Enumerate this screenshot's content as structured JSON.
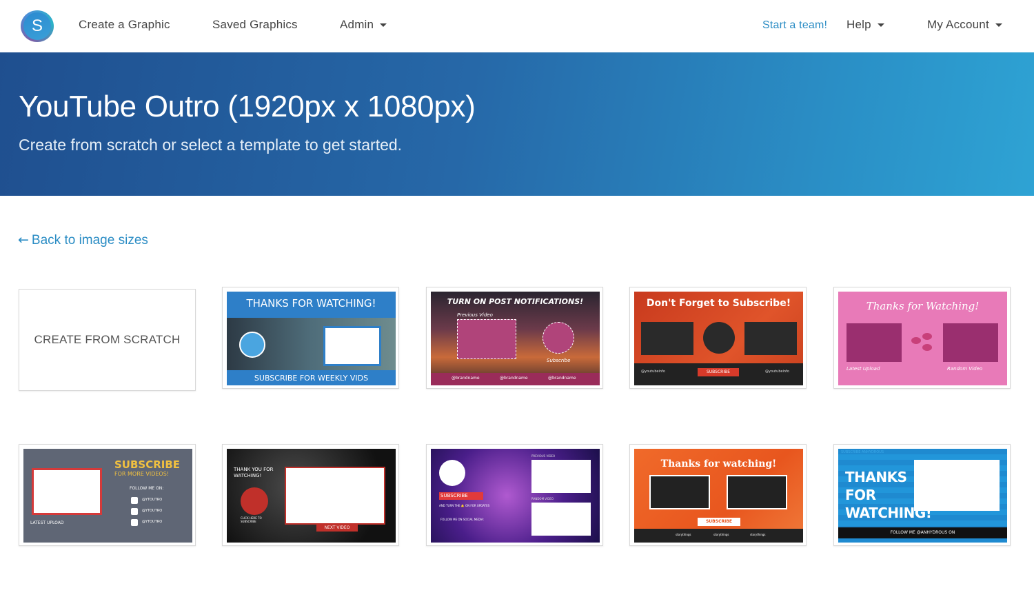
{
  "nav": {
    "logo_letter": "S",
    "create": "Create a Graphic",
    "saved": "Saved Graphics",
    "admin": "Admin",
    "team": "Start a team!",
    "help": "Help",
    "account": "My Account"
  },
  "banner": {
    "title": "YouTube Outro (1920px x 1080px)",
    "subtitle": "Create from scratch or select a template to get started."
  },
  "back_link": {
    "arrow": "←",
    "label": "Back to image sizes"
  },
  "scratch_label": "CREATE FROM SCRATCH",
  "templates": [
    {
      "heading": "THANKS FOR WATCHING!",
      "footer": "SUBSCRIBE FOR WEEKLY VIDS"
    },
    {
      "heading": "TURN ON POST NOTIFICATIONS!",
      "left": "Previous Video",
      "right": "Subscribe",
      "social_1": "@brandname",
      "social_2": "@brandname",
      "social_3": "@brandname"
    },
    {
      "heading": "Don't Forget to Subscribe!",
      "button": "SUBSCRIBE",
      "social_1": "@youtubeinfo",
      "social_2": "@youtubeinfo"
    },
    {
      "heading": "Thanks for Watching!",
      "left": "Latest Upload",
      "right": "Random Video"
    },
    {
      "heading": "SUBSCRIBE",
      "sub": "FOR MORE VIDEOS!",
      "follow": "FOLLOW ME ON:",
      "h1": "@YTOUTRO",
      "h2": "@YTOUTRO",
      "h3": "@YTOUTRO",
      "latest": "LATEST UPLOAD"
    },
    {
      "heading": "THANK YOU FOR WATCHING!",
      "click": "CLICK HERE TO SUBSCRIBE",
      "next": "NEXT VIDEO"
    },
    {
      "subscribe": "SUBSCRIBE",
      "notify": "AND TURN THE 🔔 ON FOR UPDATES",
      "follow": "FOLLOW ME ON SOCIAL MEDIA:",
      "prev": "PREVIOUS VIDEO",
      "random": "RANDOM VIDEO"
    },
    {
      "heading": "Thanks for watching!",
      "button": "SUBSCRIBE",
      "s1": "storythings",
      "s2": "storythings",
      "s3": "storythings"
    },
    {
      "heading": "THANKS FOR WATCHING!",
      "footer": "FOLLOW ME @ANHYDROUS ON",
      "bg_word": "SUBSCRIBE ANHYDROUS"
    }
  ],
  "colors": {
    "accent": "#2a8cc4",
    "banner_start": "#1f4f8f",
    "banner_end": "#2ea3d4"
  }
}
